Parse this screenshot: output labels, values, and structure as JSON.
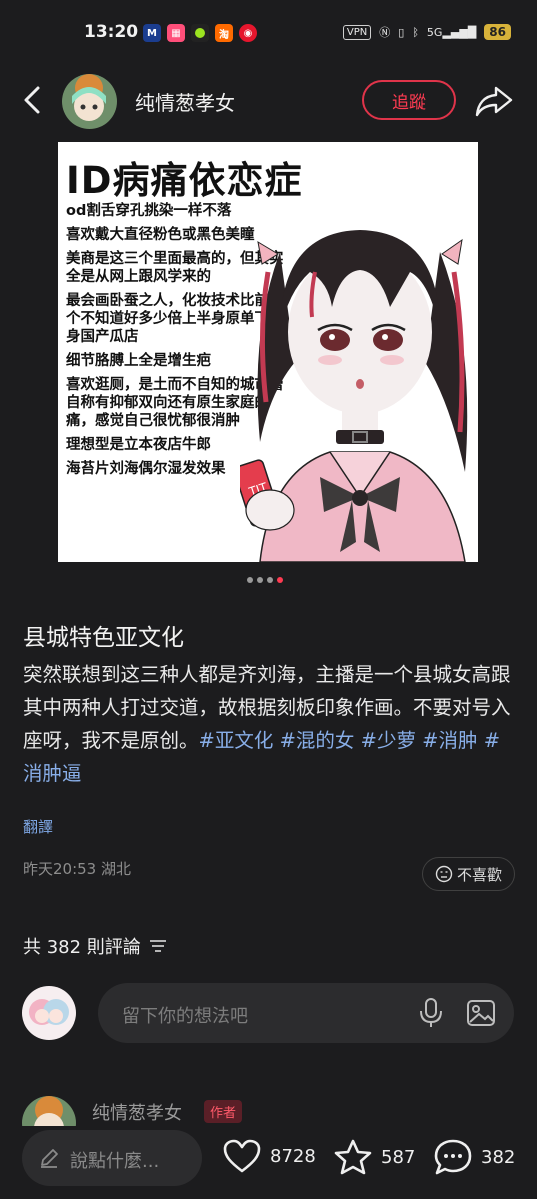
{
  "status_bar": {
    "time": "13:20",
    "vpn": "VPN",
    "network": "5G",
    "battery": "86"
  },
  "header": {
    "username": "纯情葱孝女",
    "follow_label": "追蹤"
  },
  "image": {
    "title": "ID病痛依恋症",
    "lines": [
      "od割舌穿孔挑染一样不落",
      "喜欢戴大直径粉色或黑色美瞳",
      "美商是这三个里面最高的，但其实全是从网上跟风学来的",
      "最会画卧蚕之人，化妆技术比前两个不知道好多少倍上半身原单下半身国产瓜店",
      "细节胳膊上全是增生疤",
      "喜欢逛厕，是土而不自知的城市蕾自称有抑郁双向还有原生家庭的痛，感觉自己很忧郁很消肿",
      "理想型是立本夜店牛郎",
      "海苔片刘海偶尔湿发效果"
    ],
    "can_text": "TIT",
    "page_count": 4,
    "active_page": 4
  },
  "post": {
    "title": "县城特色亚文化",
    "body": "突然联想到这三种人都是齐刘海，主播是一个县城女高跟其中两种人打过交道，故根据刻板印象作画。不要对号入座呀，我不是原创。",
    "tags": [
      "#亚文化",
      "#混的女",
      "#少萝",
      "#消肿",
      "#消肿逼"
    ],
    "translate_label": "翻譯",
    "meta": "昨天20:53 湖北",
    "dislike_label": "不喜歡"
  },
  "comments": {
    "count_label": "共 382 則評論",
    "input_placeholder": "留下你的想法吧",
    "first_author": "纯情葱孝女",
    "first_badge": "作者"
  },
  "bottom_bar": {
    "say_placeholder": "說點什麼...",
    "likes": "8728",
    "favorites": "587",
    "comments": "382"
  },
  "colors": {
    "background": "#1c1c1e",
    "accent": "#ff3b52",
    "tag": "#88aee8"
  }
}
